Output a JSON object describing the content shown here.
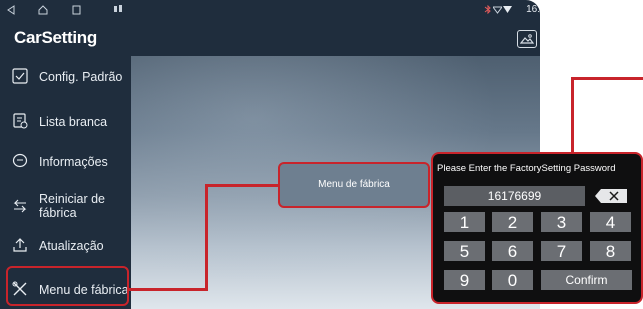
{
  "status_bar": {
    "time": "16:"
  },
  "app": {
    "title": "CarSetting"
  },
  "sidebar": {
    "items": [
      {
        "label": "Config. Padrão",
        "icon": "checkbox-icon"
      },
      {
        "label": "Lista branca",
        "icon": "whitelist-doc-icon"
      },
      {
        "label": "Informações",
        "icon": "chat-bubble-icon"
      },
      {
        "label": "Reiniciar de fábrica",
        "icon": "reset-arrow-icon"
      },
      {
        "label": "Atualização",
        "icon": "upload-icon"
      },
      {
        "label": "Menu de fábrica",
        "icon": "tools-icon"
      }
    ]
  },
  "factory_menu": {
    "label": "Menu de fábrica"
  },
  "password_dialog": {
    "title": "Please Enter the FactorySetting Password",
    "value": "16176699",
    "keys": [
      "1",
      "2",
      "3",
      "4",
      "5",
      "6",
      "7",
      "8",
      "9",
      "0"
    ],
    "confirm_label": "Confirm"
  },
  "colors": {
    "highlight": "#c8242b",
    "screen_bg": "#1f2d3d",
    "dialog_bg": "#0f0f10",
    "key_bg": "#6b6e73"
  }
}
